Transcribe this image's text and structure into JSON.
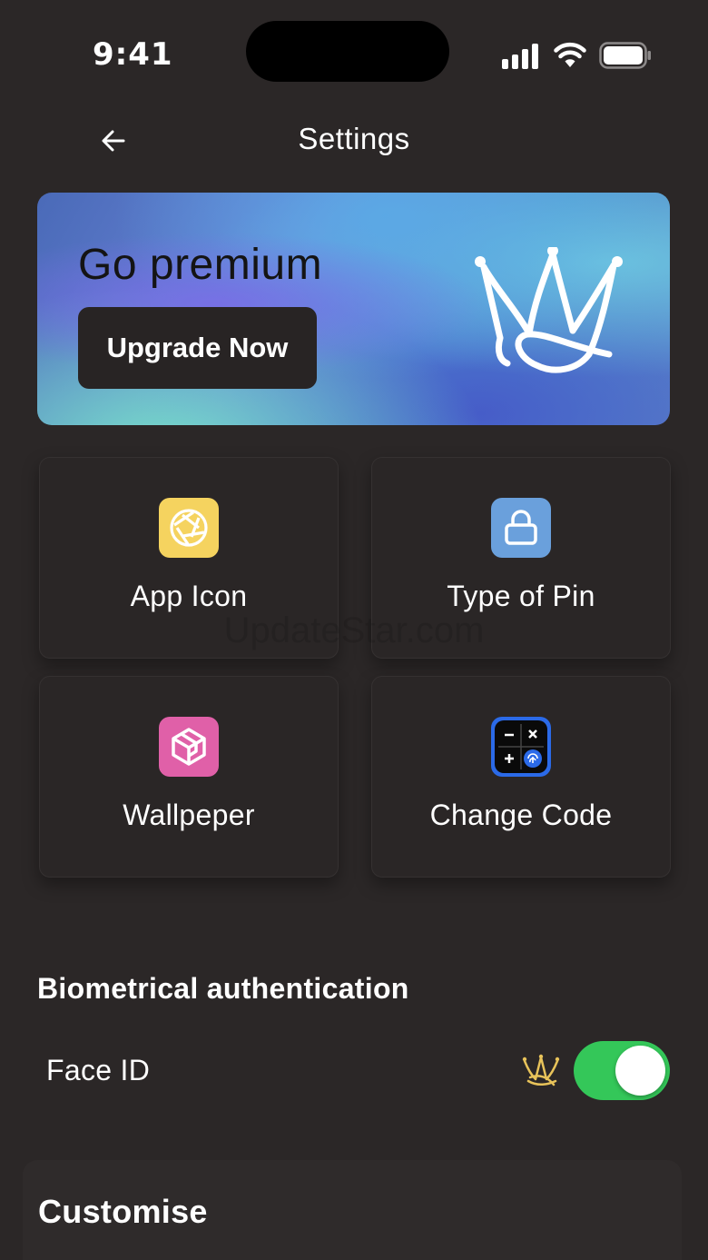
{
  "status_bar": {
    "time": "9:41",
    "icons": [
      "signal-icon",
      "wifi-icon",
      "battery-icon"
    ]
  },
  "header": {
    "back_icon": "arrow-left-icon",
    "title": "Settings"
  },
  "premium": {
    "title": "Go premium",
    "button_label": "Upgrade Now",
    "icon": "crown-icon"
  },
  "tiles": [
    {
      "label": "App Icon",
      "icon": "aperture-icon",
      "color": "#f5d35f"
    },
    {
      "label": "Type of Pin",
      "icon": "lock-icon",
      "color": "#6aa0dc"
    },
    {
      "label": "Wallpeper",
      "icon": "cube-icon",
      "color": "#e060a8"
    },
    {
      "label": "Change Code",
      "icon": "calculator-icon",
      "color": "#2b6ae8"
    }
  ],
  "biometric": {
    "section_title": "Biometrical authentication",
    "face_id_label": "Face ID",
    "premium_icon": "crown-icon",
    "toggle_on": true,
    "toggle_color": "#34c759"
  },
  "customise": {
    "title": "Customise"
  },
  "watermark": "UpdateStar.com"
}
